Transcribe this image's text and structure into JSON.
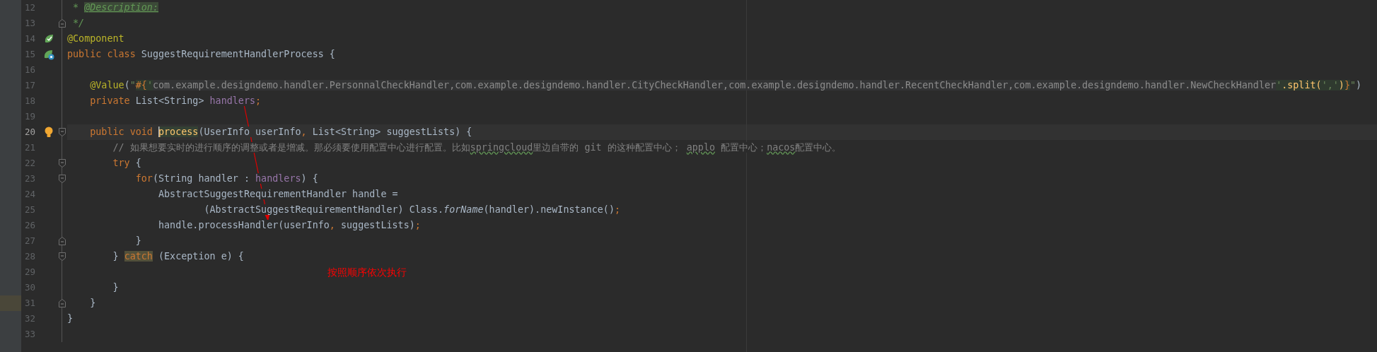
{
  "editor": {
    "lines": [
      {
        "number": "12",
        "tokens": [
          {
            "text": " * ",
            "kind": "doc"
          },
          {
            "text": "@Description:",
            "kind": "doc-tag"
          }
        ]
      },
      {
        "number": "13",
        "fold": {
          "kind": "end"
        },
        "tokens": [
          {
            "text": " */",
            "kind": "doc"
          }
        ]
      },
      {
        "number": "14",
        "gutter_icon": {
          "kind": "bean"
        },
        "tokens": [
          {
            "text": "@Component",
            "kind": "annotation"
          }
        ]
      },
      {
        "number": "15",
        "gutter_icon": {
          "kind": "bean-nav"
        },
        "tokens": [
          {
            "text": "public class ",
            "kind": "keyword"
          },
          {
            "text": "SuggestRequirementHandlerProcess {",
            "kind": "plain"
          }
        ]
      },
      {
        "number": "16"
      },
      {
        "number": "17",
        "tokens": [
          {
            "text": "    @Value",
            "kind": "annotation"
          },
          {
            "text": "(",
            "kind": "plain"
          },
          {
            "text": "\"",
            "kind": "string"
          },
          {
            "text": "#{",
            "kind": "inject-brace"
          },
          {
            "text": "'",
            "kind": "inject-string"
          },
          {
            "text": "com.example.designdemo.handler.PersonnalCheckHandler,com.example.designdemo.handler.CityCheckHandler,com.example.designdemo.handler.RecentCheckHandler,com.example.designdemo.handler.NewCheckHandler",
            "kind": "inject"
          },
          {
            "text": "'",
            "kind": "inject-string"
          },
          {
            "text": ".split(",
            "kind": "inject-call"
          },
          {
            "text": "','",
            "kind": "inject-string"
          },
          {
            "text": ")",
            "kind": "inject-call"
          },
          {
            "text": "}",
            "kind": "inject-brace"
          },
          {
            "text": "\"",
            "kind": "string"
          },
          {
            "text": ")",
            "kind": "plain"
          }
        ]
      },
      {
        "number": "18",
        "tokens": [
          {
            "text": "    private ",
            "kind": "keyword"
          },
          {
            "text": "List<String> ",
            "kind": "plain"
          },
          {
            "text": "handlers",
            "kind": "field"
          },
          {
            "text": ";",
            "kind": "keyword"
          }
        ]
      },
      {
        "number": "19"
      },
      {
        "number": "20",
        "current": true,
        "fold": {
          "kind": "start"
        },
        "gutter_icon": {
          "kind": "bulb"
        },
        "tokens": [
          {
            "text": "    public void ",
            "kind": "keyword"
          },
          {
            "text": "process",
            "kind": "method-match",
            "caret": true
          },
          {
            "text": "(UserInfo userInfo",
            "kind": "plain"
          },
          {
            "text": ", ",
            "kind": "keyword"
          },
          {
            "text": "List<String> suggestLists) {",
            "kind": "plain"
          }
        ]
      },
      {
        "number": "21",
        "tokens": [
          {
            "text": "        // 如果想要实时的进行顺序的调整或者是增减。那必须要使用配置中心进行配置。比如",
            "kind": "comment"
          },
          {
            "text": "springcloud",
            "kind": "typo"
          },
          {
            "text": "里边自带的 git 的这种配置中心； ",
            "kind": "comment"
          },
          {
            "text": "applo",
            "kind": "typo"
          },
          {
            "text": " 配置中心；",
            "kind": "comment"
          },
          {
            "text": "nacos",
            "kind": "typo"
          },
          {
            "text": "配置中心。",
            "kind": "comment"
          }
        ]
      },
      {
        "number": "22",
        "fold": {
          "kind": "start"
        },
        "tokens": [
          {
            "text": "        try",
            "kind": "keyword"
          },
          {
            "text": " {",
            "kind": "plain"
          }
        ]
      },
      {
        "number": "23",
        "fold": {
          "kind": "start"
        },
        "tokens": [
          {
            "text": "            for",
            "kind": "keyword"
          },
          {
            "text": "(String handler : ",
            "kind": "plain"
          },
          {
            "text": "handlers",
            "kind": "field"
          },
          {
            "text": ") {",
            "kind": "plain"
          }
        ]
      },
      {
        "number": "24",
        "tokens": [
          {
            "text": "                AbstractSuggestRequirementHandler handle =",
            "kind": "plain"
          }
        ]
      },
      {
        "number": "25",
        "tokens": [
          {
            "text": "                        (AbstractSuggestRequirementHandler) Class.",
            "kind": "plain"
          },
          {
            "text": "forName",
            "kind": "italic"
          },
          {
            "text": "(handler).newInstance()",
            "kind": "plain"
          },
          {
            "text": ";",
            "kind": "keyword"
          }
        ]
      },
      {
        "number": "26",
        "tokens": [
          {
            "text": "                handle.processHandler(userInfo",
            "kind": "plain"
          },
          {
            "text": ", ",
            "kind": "keyword"
          },
          {
            "text": "suggestLists)",
            "kind": "plain"
          },
          {
            "text": ";",
            "kind": "keyword"
          }
        ]
      },
      {
        "number": "27",
        "fold": {
          "kind": "end"
        },
        "tokens": [
          {
            "text": "            }",
            "kind": "plain"
          }
        ]
      },
      {
        "number": "28",
        "fold": {
          "kind": "start"
        },
        "tokens": [
          {
            "text": "        } ",
            "kind": "plain"
          },
          {
            "text": "catch",
            "kind": "keyword-occurrence"
          },
          {
            "text": " (Exception e) {",
            "kind": "plain"
          }
        ]
      },
      {
        "number": "29"
      },
      {
        "number": "30",
        "tokens": [
          {
            "text": "        }",
            "kind": "plain"
          }
        ]
      },
      {
        "number": "31",
        "marked": true,
        "fold": {
          "kind": "end"
        },
        "tokens": [
          {
            "text": "    }",
            "kind": "plain"
          }
        ]
      },
      {
        "number": "32",
        "tokens": [
          {
            "text": "}",
            "kind": "plain"
          }
        ]
      },
      {
        "number": "33"
      }
    ]
  },
  "annotation": {
    "text": "按照顺序依次执行"
  }
}
